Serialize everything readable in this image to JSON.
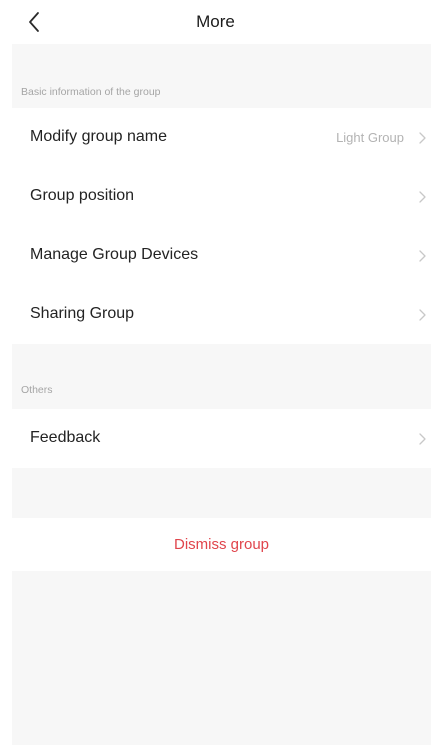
{
  "header": {
    "title": "More"
  },
  "sections": {
    "basic": {
      "title": "Basic information of the group",
      "items": [
        {
          "label": "Modify group name",
          "value": "Light Group"
        },
        {
          "label": "Group position"
        },
        {
          "label": "Manage Group Devices"
        },
        {
          "label": "Sharing Group"
        }
      ]
    },
    "others": {
      "title": "Others",
      "items": [
        {
          "label": "Feedback"
        }
      ]
    }
  },
  "actions": {
    "dismiss_label": "Dismiss group"
  },
  "colors": {
    "dismiss": "#e0454c",
    "background": "#f7f7f7",
    "secondary_text": "#b3b3b3"
  },
  "icons": {
    "back": "chevron-left-icon",
    "row_arrow": "chevron-right-icon"
  }
}
